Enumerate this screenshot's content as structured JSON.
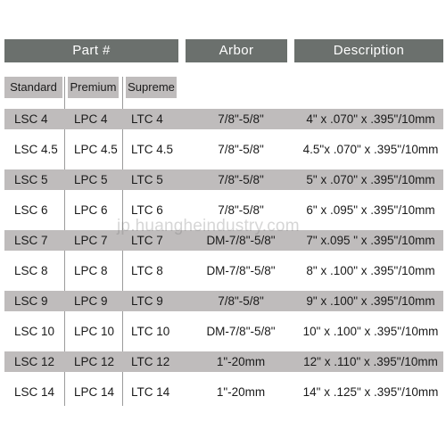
{
  "table": {
    "group_headers": [
      {
        "label": "Part #"
      },
      {
        "label": "Arbor"
      },
      {
        "label": "Description"
      }
    ],
    "sub_headers": [
      {
        "label": "Standard"
      },
      {
        "label": "Premium"
      },
      {
        "label": "Supreme"
      }
    ],
    "rows": [
      {
        "standard": "LSC  4",
        "premium": "LPC  4",
        "supreme": "LTC  4",
        "arbor": "7/8\"-5/8\"",
        "description": "4\" x .070\" x .395\"/10mm"
      },
      {
        "standard": "LSC  4.5",
        "premium": "LPC  4.5",
        "supreme": "LTC  4.5",
        "arbor": "7/8\"-5/8\"",
        "description": "4.5\"x .070\" x .395\"/10mm"
      },
      {
        "standard": "LSC  5",
        "premium": "LPC  5",
        "supreme": "LTC  5",
        "arbor": "7/8\"-5/8\"",
        "description": "5\" x .070\" x .395\"/10mm"
      },
      {
        "standard": "LSC  6",
        "premium": "LPC  6",
        "supreme": "LTC  6",
        "arbor": "7/8\"-5/8\"",
        "description": "6\" x .095\" x .395\"/10mm"
      },
      {
        "standard": "LSC  7",
        "premium": "LPC  7",
        "supreme": "LTC  7",
        "arbor": "DM-7/8\"-5/8\"",
        "description": "7\" x.095 \" x .395\"/10mm"
      },
      {
        "standard": "LSC  8",
        "premium": "LPC  8",
        "supreme": "LTC  8",
        "arbor": "DM-7/8\"-5/8\"",
        "description": "8\" x .100\" x .395\"/10mm"
      },
      {
        "standard": "LSC  9",
        "premium": "LPC  9",
        "supreme": "LTC  9",
        "arbor": "7/8\"-5/8\"",
        "description": "9\" x .100\" x .395\"/10mm"
      },
      {
        "standard": "LSC  10",
        "premium": "LPC  10",
        "supreme": "LTC  10",
        "arbor": "DM-7/8\"-5/8\"",
        "description": "10\" x .100\" x .395\"/10mm"
      },
      {
        "standard": "LSC  12",
        "premium": "LPC  12",
        "supreme": "LTC  12",
        "arbor": "1\"-20mm",
        "description": "12\" x .110\" x .395\"/10mm"
      },
      {
        "standard": "LSC  14",
        "premium": "LPC  14",
        "supreme": "LTC  14",
        "arbor": "1\"-20mm",
        "description": "14\" x .125\" x .395\"/10mm"
      }
    ]
  },
  "watermark": {
    "text": "jp.huangheindustry.com"
  },
  "colors": {
    "header_bar": "#6b706d",
    "header_text": "#ffffff",
    "stripe": "#bfbcbc",
    "body_text": "#1a1a1a",
    "divider": "#9b9b9b",
    "background": "#ffffff"
  }
}
